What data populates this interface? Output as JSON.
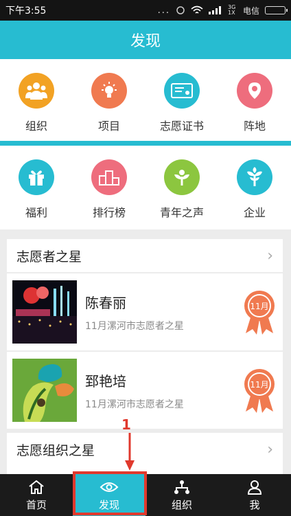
{
  "status": {
    "time": "下午3:55",
    "dots": "...",
    "network": "3G 1X",
    "carrier": "电信"
  },
  "header": {
    "title": "发现"
  },
  "grid1": [
    {
      "label": "组织",
      "icon": "people-icon",
      "color": "#f2a224"
    },
    {
      "label": "项目",
      "icon": "bulb-icon",
      "color": "#f07a50"
    },
    {
      "label": "志愿证书",
      "icon": "certificate-icon",
      "color": "#27bcd1"
    },
    {
      "label": "阵地",
      "icon": "pin-icon",
      "color": "#ee6d7d"
    }
  ],
  "grid2": [
    {
      "label": "福利",
      "icon": "gift-icon",
      "color": "#27bcd1"
    },
    {
      "label": "排行榜",
      "icon": "podium-icon",
      "color": "#ee6d7d"
    },
    {
      "label": "青年之声",
      "icon": "sprout-icon",
      "color": "#8cc63f"
    },
    {
      "label": "企业",
      "icon": "tree-icon",
      "color": "#27bcd1"
    }
  ],
  "sections": {
    "volunteer_star": "志愿者之星",
    "org_star": "志愿组织之星"
  },
  "stars": [
    {
      "name": "陈春丽",
      "subtitle": "11月漯河市志愿者之星",
      "badge": "11月"
    },
    {
      "name": "郅艳培",
      "subtitle": "11月漯河市志愿者之星",
      "badge": "11月"
    }
  ],
  "tabs": [
    {
      "label": "首页",
      "icon": "home-icon"
    },
    {
      "label": "发现",
      "icon": "eye-icon"
    },
    {
      "label": "组织",
      "icon": "org-icon"
    },
    {
      "label": "我",
      "icon": "user-icon"
    }
  ],
  "annotation": {
    "number": "1",
    "color": "#e0392d"
  }
}
